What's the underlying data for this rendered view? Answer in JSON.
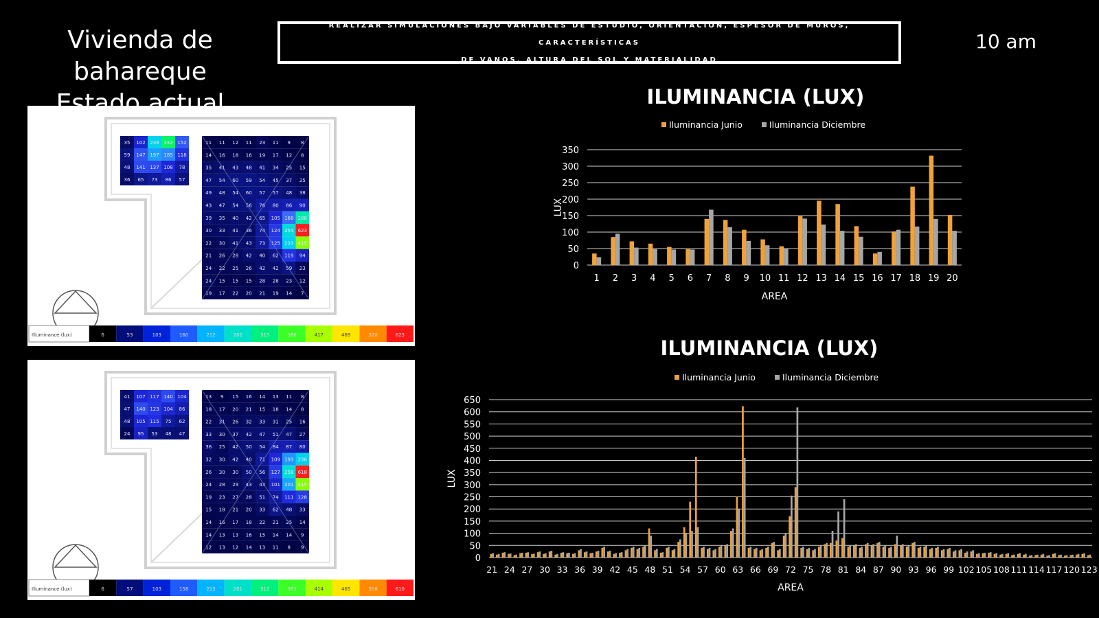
{
  "header": {
    "title_line1": "Vivienda de bahareque",
    "title_line2": "Estado actual",
    "banner_line1": "REALIZAR SIMULACIONES BAJO VARIABLES DE ESTUDIO, ORIENTACIÓN, ESPESOR DE MUROS, CARACTERÍSTICAS",
    "banner_line2": "DE VANOS, ALTURA DEL SOL Y MATERIALIDAD",
    "time": "10 am"
  },
  "colors": {
    "junio": "#f0a23a",
    "diciembre": "#a6a6a6",
    "background": "#000000",
    "grid": "#cfcfcf"
  },
  "plans": [
    {
      "legend_label": "Illuminance (lux)",
      "scale": [
        "6",
        "53",
        "103",
        "160",
        "212",
        "262",
        "315",
        "366",
        "417",
        "469",
        "520",
        "623"
      ],
      "left_grid": [
        [
          35,
          102,
          238,
          332,
          152
        ],
        [
          59,
          147,
          197,
          185,
          118
        ],
        [
          48,
          141,
          137,
          108,
          78
        ],
        [
          36,
          65,
          73,
          86,
          57
        ]
      ],
      "right_grid": [
        [
          11,
          11,
          12,
          11,
          23,
          11,
          9,
          8
        ],
        [
          14,
          16,
          18,
          16,
          19,
          17,
          12,
          8
        ],
        [
          35,
          41,
          43,
          48,
          41,
          34,
          25,
          15
        ],
        [
          47,
          54,
          60,
          59,
          54,
          45,
          37,
          25
        ],
        [
          49,
          48,
          54,
          60,
          57,
          57,
          48,
          38
        ],
        [
          43,
          47,
          54,
          56,
          76,
          80,
          86,
          90
        ],
        [
          39,
          35,
          40,
          42,
          65,
          105,
          168,
          288
        ],
        [
          30,
          33,
          41,
          36,
          74,
          124,
          254,
          623
        ],
        [
          22,
          30,
          41,
          43,
          73,
          125,
          233,
          415
        ],
        [
          21,
          26,
          28,
          42,
          40,
          62,
          119,
          94
        ],
        [
          24,
          22,
          25,
          26,
          42,
          42,
          59,
          23
        ],
        [
          24,
          15,
          15,
          15,
          28,
          28,
          23,
          12
        ],
        [
          19,
          17,
          22,
          20,
          21,
          19,
          14,
          7
        ]
      ]
    },
    {
      "legend_label": "Illuminance (lux)",
      "scale": [
        "6",
        "57",
        "103",
        "158",
        "213",
        "261",
        "312",
        "363",
        "414",
        "465",
        "516",
        "610"
      ],
      "left_grid": [
        [
          41,
          107,
          117,
          140,
          104
        ],
        [
          47,
          140,
          123,
          104,
          86
        ],
        [
          48,
          105,
          115,
          75,
          62
        ],
        [
          24,
          95,
          53,
          48,
          47
        ]
      ],
      "right_grid": [
        [
          13,
          9,
          15,
          16,
          14,
          13,
          11,
          8
        ],
        [
          18,
          17,
          20,
          21,
          15,
          18,
          14,
          8
        ],
        [
          22,
          31,
          26,
          32,
          33,
          31,
          25,
          16
        ],
        [
          33,
          30,
          37,
          42,
          47,
          51,
          47,
          27
        ],
        [
          36,
          25,
          42,
          50,
          54,
          84,
          87,
          80
        ],
        [
          32,
          30,
          42,
          40,
          71,
          109,
          193,
          236
        ],
        [
          26,
          30,
          30,
          50,
          56,
          127,
          258,
          618
        ],
        [
          24,
          28,
          29,
          43,
          43,
          101,
          201,
          415
        ],
        [
          19,
          23,
          27,
          28,
          51,
          74,
          111,
          128
        ],
        [
          15,
          18,
          21,
          20,
          33,
          62,
          48,
          33
        ],
        [
          14,
          16,
          17,
          18,
          22,
          21,
          25,
          14
        ],
        [
          14,
          13,
          13,
          16,
          15,
          14,
          14,
          9
        ],
        [
          12,
          13,
          12,
          14,
          13,
          11,
          8,
          9
        ]
      ]
    }
  ],
  "chart_data": [
    {
      "type": "bar",
      "title": "ILUMINANCIA (LUX)",
      "xlabel": "AREA",
      "ylabel": "LUX",
      "ylim": [
        0,
        350
      ],
      "yticks": [
        0,
        50,
        100,
        150,
        200,
        250,
        300,
        350
      ],
      "grid": true,
      "legend": "top",
      "categories": [
        "1",
        "2",
        "3",
        "4",
        "5",
        "6",
        "7",
        "8",
        "9",
        "10",
        "11",
        "12",
        "13",
        "14",
        "15",
        "16",
        "17",
        "18",
        "19",
        "20"
      ],
      "series": [
        {
          "name": "Iluminancia Junio",
          "values": [
            35,
            85,
            72,
            65,
            55,
            48,
            140,
            137,
            107,
            78,
            57,
            148,
            195,
            185,
            118,
            35,
            102,
            238,
            332,
            152
          ]
        },
        {
          "name": "Iluminancia Diciembre",
          "values": [
            24,
            95,
            53,
            48,
            47,
            47,
            168,
            115,
            73,
            60,
            50,
            141,
            123,
            104,
            86,
            40,
            107,
            117,
            140,
            104
          ]
        }
      ]
    },
    {
      "type": "bar",
      "title": "ILUMINANCIA (LUX)",
      "xlabel": "AREA",
      "ylabel": "LUX",
      "ylim": [
        0,
        650
      ],
      "yticks": [
        0,
        50,
        100,
        150,
        200,
        250,
        300,
        350,
        400,
        450,
        500,
        550,
        600,
        650
      ],
      "grid": true,
      "legend": "top",
      "x_start": 21,
      "tick_labels": [
        "21",
        "24",
        "27",
        "30",
        "33",
        "36",
        "39",
        "42",
        "45",
        "48",
        "51",
        "54",
        "57",
        "60",
        "63",
        "66",
        "69",
        "72",
        "75",
        "78",
        "81",
        "84",
        "87",
        "90",
        "93",
        "96",
        "99",
        "102",
        "105",
        "108",
        "111",
        "114",
        "117",
        "120",
        "123"
      ],
      "series": [
        {
          "name": "Iluminancia Junio",
          "values": [
            15,
            12,
            20,
            15,
            10,
            18,
            20,
            14,
            22,
            15,
            25,
            12,
            20,
            18,
            15,
            30,
            22,
            18,
            25,
            40,
            25,
            15,
            20,
            30,
            40,
            35,
            45,
            120,
            30,
            20,
            40,
            30,
            65,
            125,
            230,
            415,
            40,
            35,
            30,
            45,
            50,
            110,
            250,
            623,
            40,
            35,
            30,
            40,
            60,
            30,
            90,
            170,
            290,
            40,
            35,
            30,
            45,
            55,
            60,
            70,
            80,
            45,
            50,
            40,
            55,
            50,
            60,
            45,
            40,
            55,
            50,
            45,
            60,
            40,
            45,
            35,
            40,
            30,
            35,
            25,
            30,
            20,
            25,
            15,
            18,
            20,
            15,
            12,
            15,
            10,
            15,
            12,
            8,
            10,
            12,
            8,
            15,
            10,
            8,
            10,
            12,
            15,
            10
          ]
        },
        {
          "name": "Iluminancia Diciembre",
          "values": [
            18,
            15,
            22,
            17,
            12,
            20,
            22,
            16,
            25,
            18,
            28,
            15,
            22,
            20,
            18,
            35,
            25,
            20,
            28,
            45,
            28,
            18,
            22,
            35,
            45,
            40,
            50,
            90,
            35,
            22,
            45,
            35,
            75,
            100,
            110,
            125,
            45,
            40,
            35,
            50,
            55,
            120,
            200,
            410,
            45,
            40,
            35,
            45,
            65,
            35,
            100,
            255,
            618,
            45,
            40,
            35,
            50,
            60,
            110,
            190,
            240,
            50,
            55,
            45,
            60,
            55,
            65,
            50,
            45,
            90,
            55,
            50,
            65,
            45,
            50,
            40,
            45,
            35,
            40,
            30,
            35,
            25,
            30,
            18,
            20,
            22,
            18,
            15,
            18,
            12,
            18,
            15,
            10,
            12,
            15,
            10,
            18,
            12,
            10,
            12,
            15,
            18,
            12
          ]
        }
      ]
    }
  ]
}
